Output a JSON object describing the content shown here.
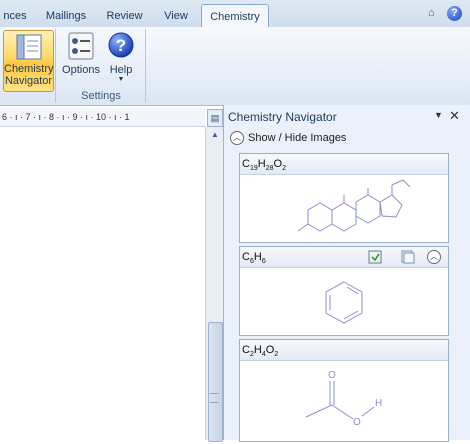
{
  "tabs": [
    {
      "label": "nces"
    },
    {
      "label": "Mailings"
    },
    {
      "label": "Review"
    },
    {
      "label": "View"
    },
    {
      "label": "Chemistry",
      "active": true
    }
  ],
  "ribbon": {
    "navigator_line1": "Chemistry",
    "navigator_line2": "Navigator",
    "options_label": "Options",
    "help_label": "Help",
    "group_label": "Settings"
  },
  "ruler": {
    "text": "6 · ı · 7 · ı · 8 · ı · 9 · ı · 10 · ı · 1"
  },
  "pane": {
    "title": "Chemistry Navigator",
    "toggle_label": "Show / Hide Images",
    "cards": [
      {
        "formula": [
          "C",
          "19",
          "H",
          "28",
          "O",
          "2"
        ]
      },
      {
        "formula": [
          "C",
          "6",
          "H",
          "6"
        ]
      },
      {
        "formula": [
          "C",
          "2",
          "H",
          "4",
          "O",
          "2"
        ]
      }
    ]
  },
  "colors": {
    "accent": "#ffd766",
    "molecule": "#8a8fd0",
    "pane_bg": "#eaf1fa"
  }
}
